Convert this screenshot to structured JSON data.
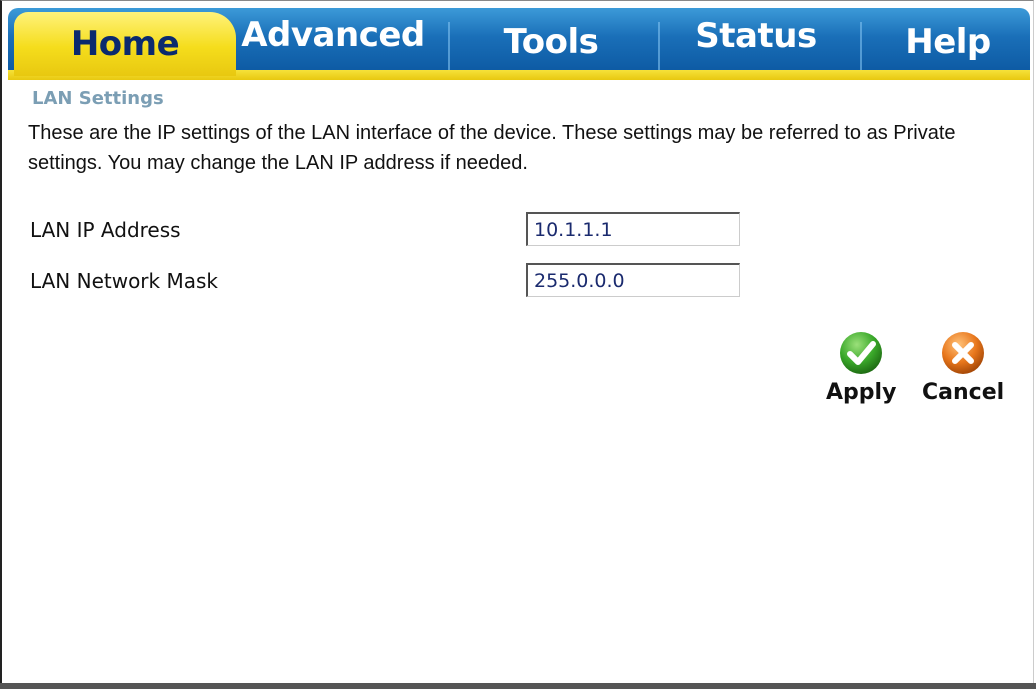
{
  "tabs": [
    {
      "label": "Home",
      "active": true
    },
    {
      "label": "Advanced",
      "active": false
    },
    {
      "label": "Tools",
      "active": false
    },
    {
      "label": "Status",
      "active": false
    },
    {
      "label": "Help",
      "active": false
    }
  ],
  "section": {
    "title": "LAN Settings",
    "description": "These are the IP settings of the LAN interface of the device. These settings may be referred to as Private settings. You may change the LAN IP address if needed."
  },
  "fields": {
    "lan_ip": {
      "label": "LAN IP Address",
      "value": "10.1.1.1"
    },
    "lan_mask": {
      "label": "LAN Network Mask",
      "value": "255.0.0.0"
    }
  },
  "actions": {
    "apply": {
      "label": "Apply",
      "icon": "checkmark-icon",
      "color": "#3aa82a"
    },
    "cancel": {
      "label": "Cancel",
      "icon": "x-icon",
      "color": "#e8771c"
    }
  },
  "colors": {
    "tab_blue": "#1a6fb8",
    "tab_yellow": "#f5dd1c",
    "active_tab_text": "#0b2a6e",
    "section_title": "#7b9eb4"
  }
}
